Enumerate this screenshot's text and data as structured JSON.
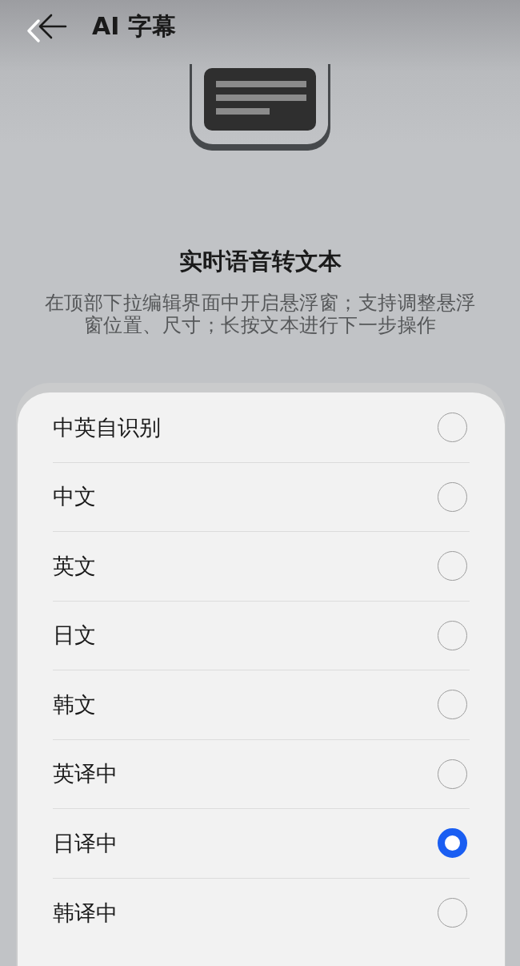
{
  "header": {
    "title": "AI 字幕"
  },
  "feature": {
    "title": "实时语音转文本",
    "description": "在顶部下拉编辑界面中开启悬浮窗；支持调整悬浮窗位置、尺寸；长按文本进行下一步操作"
  },
  "options": [
    {
      "label": "中英自识别",
      "selected": false
    },
    {
      "label": "中文",
      "selected": false
    },
    {
      "label": "英文",
      "selected": false
    },
    {
      "label": "日文",
      "selected": false
    },
    {
      "label": "韩文",
      "selected": false
    },
    {
      "label": "英译中",
      "selected": false
    },
    {
      "label": "日译中",
      "selected": true
    },
    {
      "label": "韩译中",
      "selected": false
    }
  ]
}
